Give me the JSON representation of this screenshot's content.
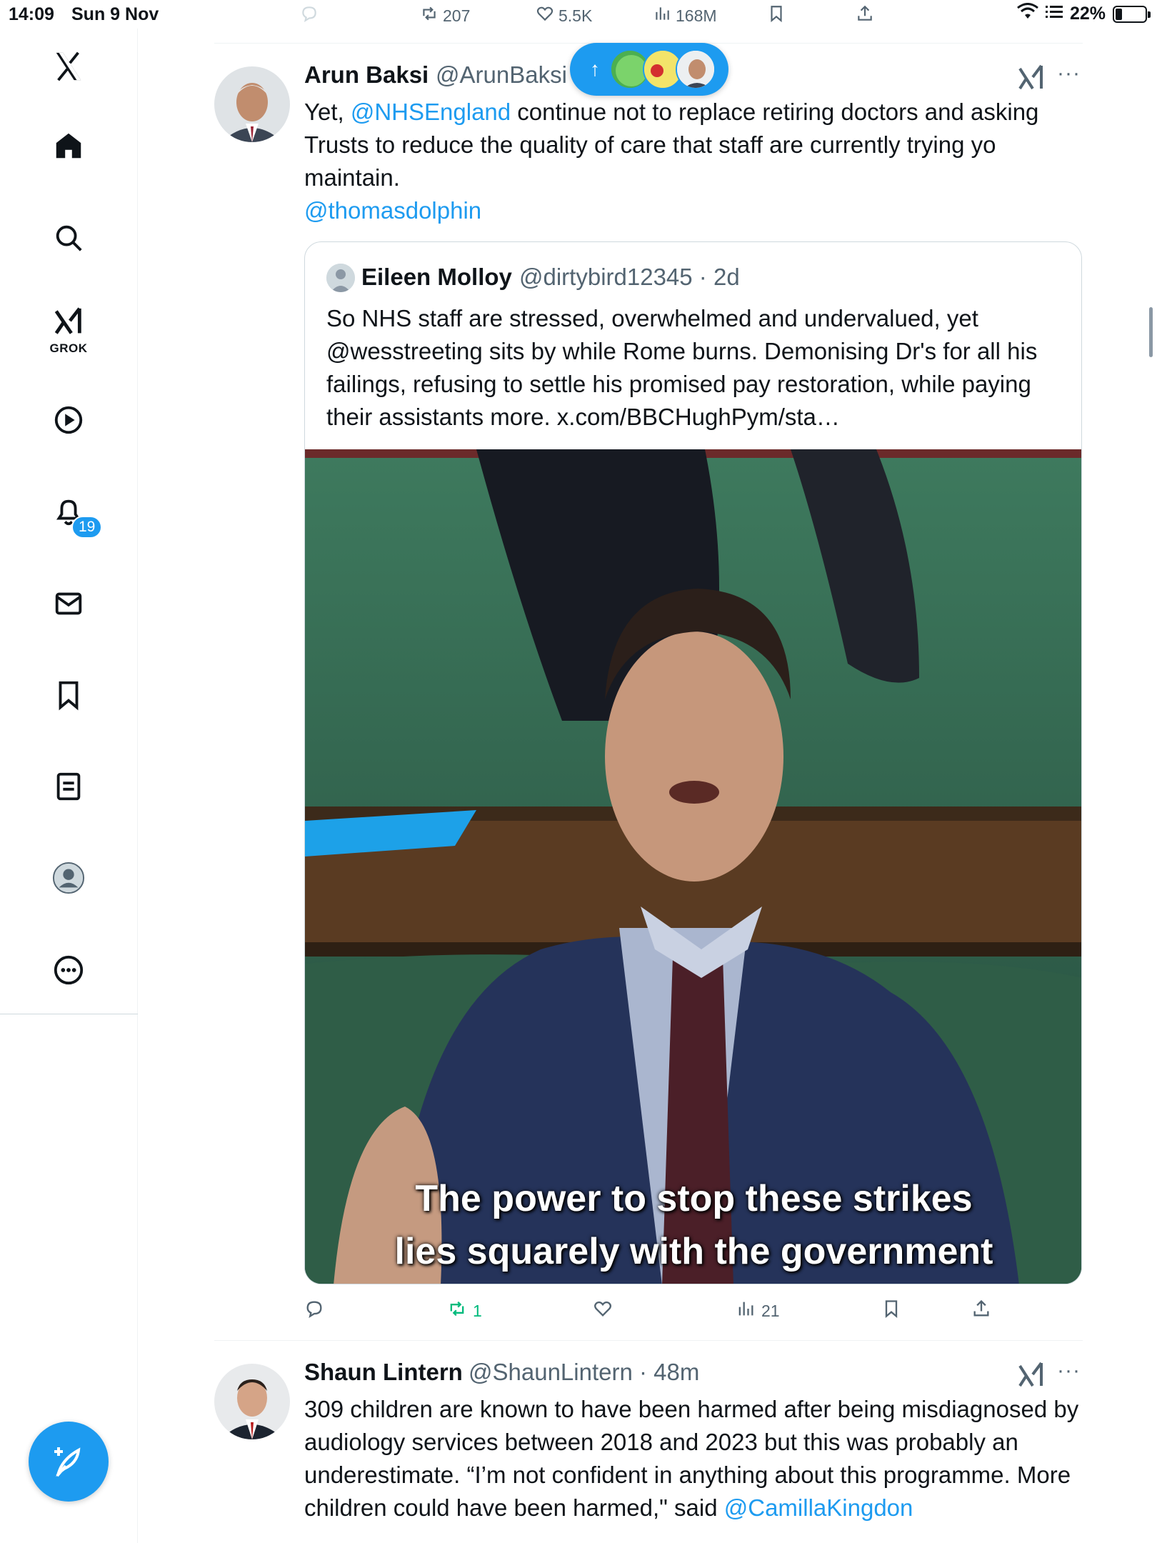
{
  "status_bar": {
    "time": "14:09",
    "date": "Sun 9 Nov",
    "battery": "22%",
    "battery_level": 0.22
  },
  "previous_tweet_actions": {
    "retweets": "207",
    "likes": "5.5K",
    "views": "168M"
  },
  "sidebar": {
    "items": [
      {
        "name": "x-logo"
      },
      {
        "name": "home"
      },
      {
        "name": "search"
      },
      {
        "name": "grok",
        "label": "GROK"
      },
      {
        "name": "video"
      },
      {
        "name": "notifications",
        "badge": "19"
      },
      {
        "name": "messages"
      },
      {
        "name": "bookmarks"
      },
      {
        "name": "lists"
      },
      {
        "name": "profile"
      },
      {
        "name": "more"
      }
    ],
    "accent": "#1d9bf0"
  },
  "tweets": [
    {
      "name": "Arun Baksi",
      "handle": "@ArunBaksi",
      "text": {
        "p1": "Yet, ",
        "m1": "@NHSEngland",
        "p2": " continue not to replace retiring doctors and asking Trusts to reduce the quality of care that staff are currently trying yo maintain.",
        "m2": "@thomasdolphin"
      },
      "quote": {
        "name": "Eileen Molloy",
        "handle": "@dirtybird12345 · 2d",
        "text": "So NHS staff are stressed, overwhelmed and undervalued, yet @wesstreeting sits by while Rome burns. Demonising Dr's for all his failings, refusing to settle his promised pay restoration, while paying their assistants more. x.com/BBCHughPym/sta…",
        "caption_line1": "The power to stop these strikes",
        "caption_line2": "lies squarely with the government"
      },
      "actions": {
        "retweets": "1",
        "views": "21"
      }
    },
    {
      "name": "Shaun Lintern",
      "handle": "@ShaunLintern · 48m",
      "text": {
        "p1": "309 children are known to have been harmed after being misdiagnosed by audiology services between 2018 and 2023 but this was probably an underestimate. “I’m not confident in anything about this programme. More children could have been harmed,\" said ",
        "m1": "@CamillaKingdon"
      }
    }
  ],
  "colors": {
    "link": "#1d9bf0",
    "retweet_active": "#00ba7c",
    "muted": "#536471"
  }
}
